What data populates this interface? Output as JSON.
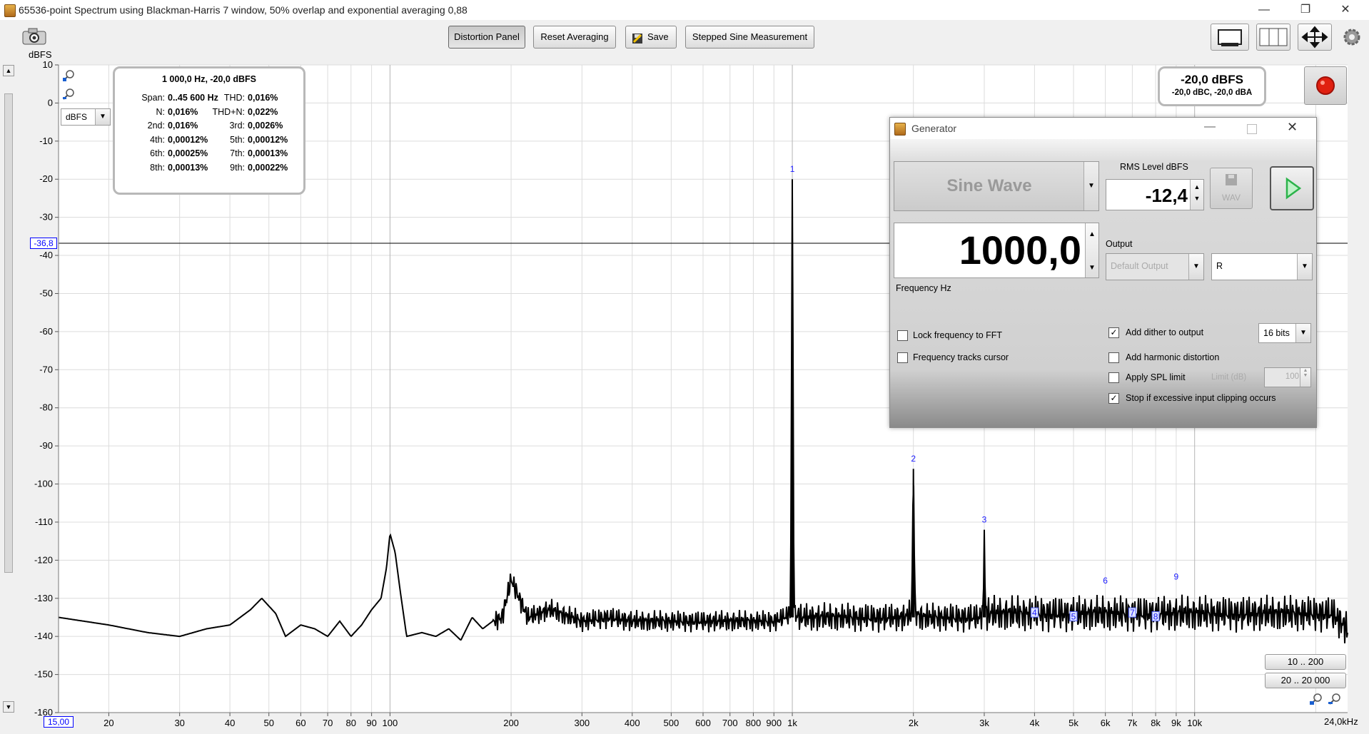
{
  "window": {
    "title": "65536-point Spectrum using Blackman-Harris 7 window, 50% overlap and exponential averaging 0,88",
    "minimize": "—",
    "maximize": "❐",
    "close": "✕"
  },
  "toolbar": {
    "distortion_panel": "Distortion Panel",
    "reset_averaging": "Reset Averaging",
    "save": "Save",
    "stepped_sine": "Stepped Sine Measurement"
  },
  "plot": {
    "y_unit": "dBFS",
    "unit_select": "dBFS",
    "cursor_level": "-36,8",
    "x_start_label": "15,00",
    "x_end_label": "24,0kHz",
    "range_buttons": [
      "10 .. 200",
      "20 .. 20 000"
    ]
  },
  "distortion_panel": {
    "header": "1 000,0 Hz, -20,0 dBFS",
    "rows": [
      {
        "l1": "Span:",
        "v1": "0..45 600 Hz",
        "l2": "THD:",
        "v2": "0,016%"
      },
      {
        "l1": "N:",
        "v1": "0,016%",
        "l2": "THD+N:",
        "v2": "0,022%"
      },
      {
        "l1": "2nd:",
        "v1": "0,016%",
        "l2": "3rd:",
        "v2": "0,0026%"
      },
      {
        "l1": "4th:",
        "v1": "0,00012%",
        "l2": "5th:",
        "v2": "0,00012%"
      },
      {
        "l1": "6th:",
        "v1": "0,00025%",
        "l2": "7th:",
        "v2": "0,00013%"
      },
      {
        "l1": "8th:",
        "v1": "0,00013%",
        "l2": "9th:",
        "v2": "0,00022%"
      }
    ]
  },
  "level_readout": {
    "main": "-20,0 dBFS",
    "sub": "-20,0 dBC, -20,0 dBA"
  },
  "generator": {
    "title": "Generator",
    "waveform": "Sine Wave",
    "rms_label": "RMS Level dBFS",
    "rms_value": "-12,4",
    "wav_label": "WAV",
    "frequency_value": "1000,0",
    "frequency_label": "Frequency Hz",
    "output_label": "Output",
    "output_device": "Default Output",
    "output_channel": "R",
    "lock_freq": "Lock frequency to FFT",
    "freq_tracks": "Frequency tracks cursor",
    "add_dither": "Add dither to output",
    "dither_bits": "16 bits",
    "add_harmonic": "Add harmonic distortion",
    "apply_spl": "Apply SPL limit",
    "limit_label": "Limit (dB)",
    "limit_value": "100",
    "stop_clipping": "Stop if excessive input clipping occurs",
    "checks": {
      "lock_freq": false,
      "freq_tracks": false,
      "add_dither": true,
      "add_harmonic": false,
      "apply_spl": false,
      "stop_clipping": true
    }
  },
  "chart_data": {
    "type": "line",
    "title": "",
    "xlabel": "",
    "ylabel": "dBFS",
    "x_scale": "log",
    "xlim": [
      15,
      24000
    ],
    "ylim": [
      -160,
      10
    ],
    "grid": true,
    "y_ticks": [
      "10",
      "0",
      "-10",
      "-20",
      "-30",
      "-40",
      "-50",
      "-60",
      "-70",
      "-80",
      "-90",
      "-100",
      "-110",
      "-120",
      "-130",
      "-140",
      "-150",
      "-160"
    ],
    "x_ticks": [
      "20",
      "30",
      "40",
      "50",
      "60",
      "70",
      "80",
      "90",
      "100",
      "200",
      "300",
      "400",
      "500",
      "600",
      "700",
      "800",
      "900",
      "1k",
      "2k",
      "3k",
      "4k",
      "5k",
      "6k",
      "7k",
      "8k",
      "9k",
      "10k"
    ],
    "x_tick_values": [
      20,
      30,
      40,
      50,
      60,
      70,
      80,
      90,
      100,
      200,
      300,
      400,
      500,
      600,
      700,
      800,
      900,
      1000,
      2000,
      3000,
      4000,
      5000,
      6000,
      7000,
      8000,
      9000,
      10000
    ],
    "series": [
      {
        "x": [
          15,
          20,
          25,
          30,
          35,
          40,
          45,
          48,
          52,
          55,
          60,
          65,
          70,
          75,
          80,
          85,
          90,
          95,
          98,
          100,
          103,
          106,
          110,
          120,
          130,
          140,
          150,
          160,
          170,
          180,
          190,
          200,
          220,
          250,
          300,
          350,
          400,
          450,
          500,
          550,
          600,
          700,
          800,
          900,
          950,
          990,
          1000,
          1010,
          1050,
          1100,
          1200,
          1300,
          1400,
          1500,
          1700,
          1900,
          1980,
          2000,
          2020,
          2100,
          2300,
          2600,
          2900,
          2980,
          3000,
          3020,
          3200,
          3500,
          4000,
          4500,
          5000,
          5500,
          6000,
          7000,
          8000,
          9000,
          10000,
          12000,
          15000,
          18000,
          20000,
          22000,
          24000
        ],
        "y": [
          -135,
          -137,
          -139,
          -140,
          -138,
          -137,
          -133,
          -130,
          -134,
          -140,
          -137,
          -138,
          -140,
          -136,
          -140,
          -137,
          -133,
          -130,
          -122,
          -113,
          -118,
          -128,
          -140,
          -139,
          -140,
          -138,
          -141,
          -135,
          -138,
          -136,
          -135,
          -125,
          -135,
          -133,
          -136,
          -135,
          -136,
          -136,
          -136,
          -136,
          -136,
          -136,
          -136,
          -136,
          -135,
          -134,
          -20,
          -134,
          -135,
          -135,
          -135,
          -135,
          -135,
          -135,
          -135,
          -135,
          -134,
          -96,
          -134,
          -135,
          -135,
          -135,
          -135,
          -134,
          -112,
          -134,
          -134,
          -134,
          -134,
          -134,
          -134,
          -134,
          -134,
          -134,
          -134,
          -134,
          -134,
          -134,
          -134,
          -134,
          -134,
          -134,
          -138
        ]
      }
    ],
    "markers": [
      {
        "label": "1",
        "x": 1000,
        "y": -20
      },
      {
        "label": "2",
        "x": 2000,
        "y": -96
      },
      {
        "label": "3",
        "x": 3000,
        "y": -112
      },
      {
        "label": "4",
        "x": 4000,
        "y": -134
      },
      {
        "label": "5",
        "x": 5000,
        "y": -135
      },
      {
        "label": "6",
        "x": 6000,
        "y": -128
      },
      {
        "label": "7",
        "x": 7000,
        "y": -134
      },
      {
        "label": "8",
        "x": 8000,
        "y": -135
      },
      {
        "label": "9",
        "x": 9000,
        "y": -127
      }
    ],
    "cursor_y": -36.8
  },
  "colors": {
    "trace": "#000000",
    "grid": "#dcdcdc",
    "marker": "#1a1aff",
    "cursor_label": "#0000ff",
    "record": "#e02010",
    "play": "#2bb34a"
  }
}
